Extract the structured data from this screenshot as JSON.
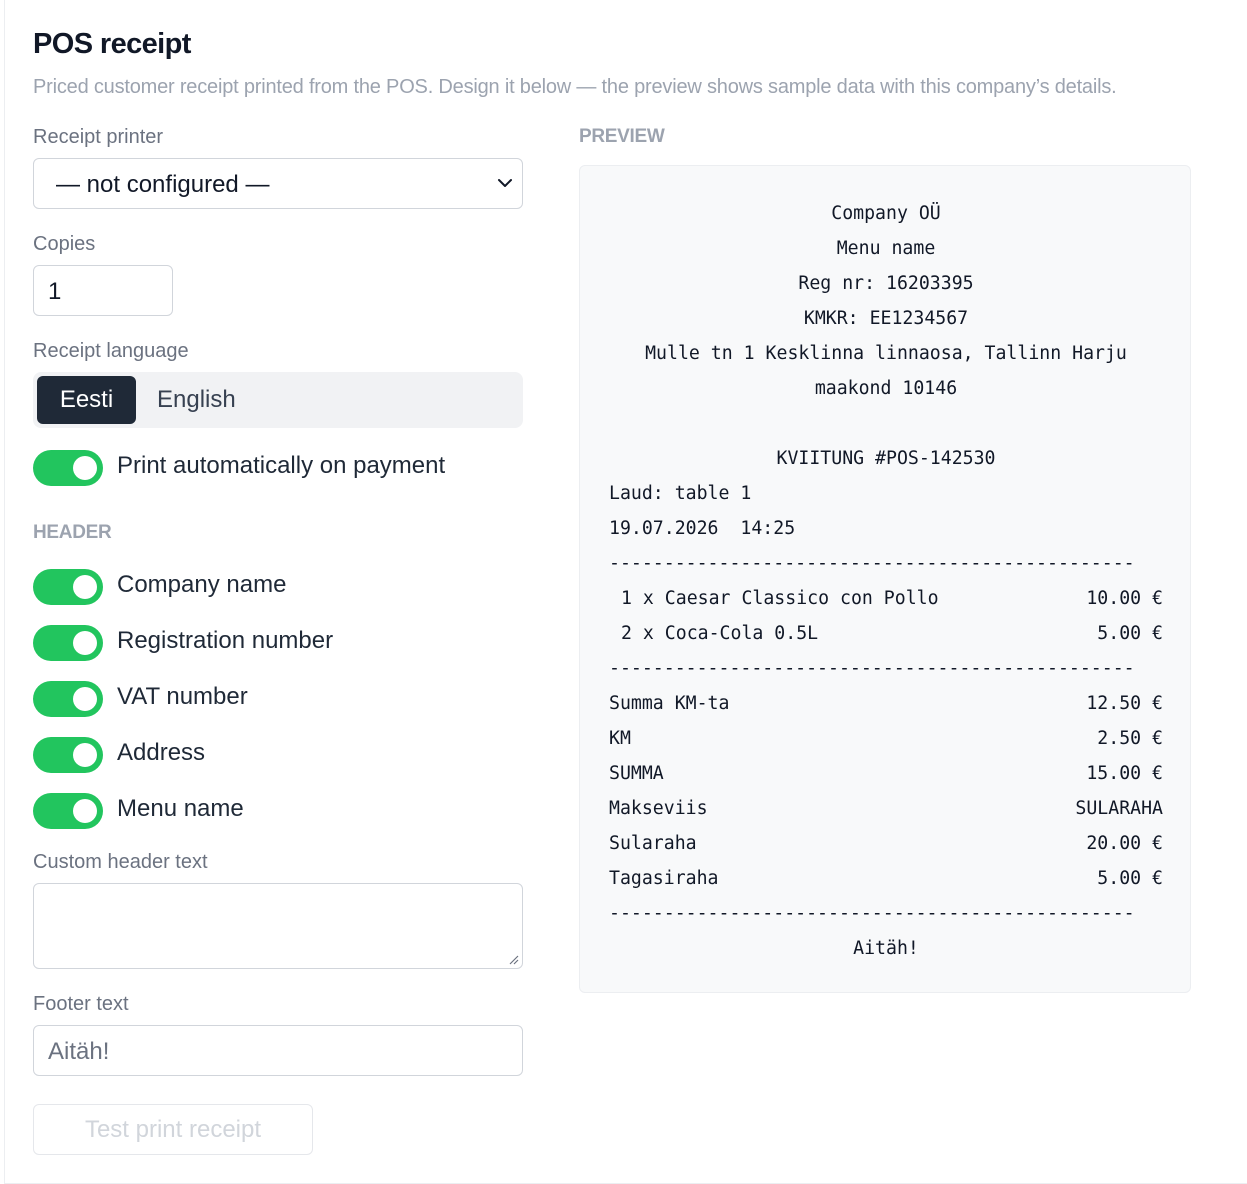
{
  "header": {
    "title": "POS receipt",
    "subtitle": "Priced customer receipt printed from the POS. Design it below — the preview shows sample data with this company’s details."
  },
  "settings": {
    "printer_label": "Receipt printer",
    "printer_value": "— not configured —",
    "copies_label": "Copies",
    "copies_value": "1",
    "language_label": "Receipt language",
    "language_options": [
      "Eesti",
      "English"
    ],
    "language_selected": "Eesti",
    "auto_print_label": "Print automatically on payment",
    "auto_print_on": true,
    "header_section_label": "HEADER",
    "header_toggles": [
      {
        "label": "Company name",
        "on": true
      },
      {
        "label": "Registration number",
        "on": true
      },
      {
        "label": "VAT number",
        "on": true
      },
      {
        "label": "Address",
        "on": true
      },
      {
        "label": "Menu name",
        "on": true
      }
    ],
    "custom_header_label": "Custom header text",
    "custom_header_value": "",
    "footer_label": "Footer text",
    "footer_placeholder": "Aitäh!",
    "test_print_label": "Test print receipt"
  },
  "preview": {
    "label": "PREVIEW",
    "company": "Company OÜ",
    "menu_name": "Menu name",
    "reg": "Reg nr: 16203395",
    "vat": "KMKR: EE1234567",
    "address_line1": "Mulle tn 1 Kesklinna linnaosa, Tallinn Harju",
    "address_line2": "maakond 10146",
    "receipt_no": "KVIITUNG #POS-142530",
    "table": "Laud: table 1",
    "datetime": "19.07.2026  14:25",
    "separator": "------------------------------------------------",
    "items": [
      {
        "desc": "1 x Caesar Classico con Pollo",
        "amount": "10.00 €"
      },
      {
        "desc": "2 x Coca-Cola 0.5L",
        "amount": "5.00 €"
      }
    ],
    "totals": [
      {
        "label": "Summa KM-ta",
        "value": "12.50 €"
      },
      {
        "label": "KM",
        "value": "2.50 €"
      },
      {
        "label": "SUMMA",
        "value": "15.00 €"
      },
      {
        "label": "Makseviis",
        "value": "SULARAHA"
      },
      {
        "label": "Sularaha",
        "value": "20.00 €"
      },
      {
        "label": "Tagasiraha",
        "value": "5.00 €"
      }
    ],
    "footer": "Aitäh!"
  },
  "colors": {
    "toggle_on": "#22c55e",
    "segment_active": "#1f2937",
    "muted_text": "#9ca3af"
  }
}
